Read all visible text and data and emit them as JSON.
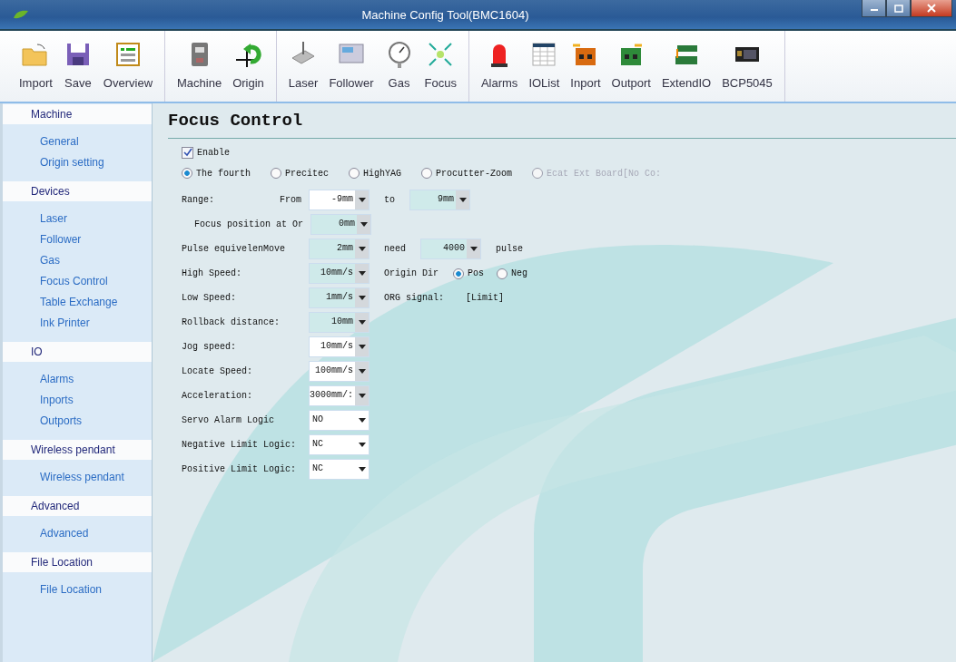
{
  "window": {
    "title": "Machine Config Tool(BMC1604)"
  },
  "toolbar": {
    "groups": [
      [
        {
          "label": "Import"
        },
        {
          "label": "Save"
        },
        {
          "label": "Overview"
        }
      ],
      [
        {
          "label": "Machine"
        },
        {
          "label": "Origin"
        }
      ],
      [
        {
          "label": "Laser"
        },
        {
          "label": "Follower"
        },
        {
          "label": "Gas"
        },
        {
          "label": "Focus"
        }
      ],
      [
        {
          "label": "Alarms"
        },
        {
          "label": "IOList"
        },
        {
          "label": "Inport"
        },
        {
          "label": "Outport"
        },
        {
          "label": "ExtendIO"
        },
        {
          "label": "BCP5045"
        }
      ]
    ]
  },
  "sidebar": {
    "sections": [
      {
        "title": "Machine",
        "items": [
          {
            "label": "General"
          },
          {
            "label": "Origin setting"
          }
        ]
      },
      {
        "title": "Devices",
        "items": [
          {
            "label": "Laser"
          },
          {
            "label": "Follower"
          },
          {
            "label": "Gas"
          },
          {
            "label": "Focus Control"
          },
          {
            "label": "Table Exchange"
          },
          {
            "label": "Ink Printer"
          }
        ]
      },
      {
        "title": "IO",
        "items": [
          {
            "label": "Alarms"
          },
          {
            "label": "Inports"
          },
          {
            "label": "Outports"
          }
        ]
      },
      {
        "title": "Wireless pendant",
        "items": [
          {
            "label": "Wireless pendant"
          }
        ]
      },
      {
        "title": "Advanced",
        "items": [
          {
            "label": "Advanced"
          }
        ]
      },
      {
        "title": "File Location",
        "items": [
          {
            "label": "File Location"
          }
        ]
      }
    ]
  },
  "page": {
    "title": "Focus Control",
    "enable": {
      "label": "Enable",
      "checked": true
    },
    "heads": [
      {
        "label": "The fourth",
        "selected": true,
        "disabled": false
      },
      {
        "label": "Precitec",
        "selected": false,
        "disabled": false
      },
      {
        "label": "HighYAG",
        "selected": false,
        "disabled": false
      },
      {
        "label": "Procutter-Zoom",
        "selected": false,
        "disabled": false
      },
      {
        "label": "Ecat Ext Board[No Co:",
        "selected": false,
        "disabled": true
      }
    ],
    "rows": [
      {
        "label": "Range:",
        "indent": false,
        "items": [
          {
            "kind": "text",
            "text": "From"
          },
          {
            "kind": "combo",
            "value": "-9mm",
            "white": true
          },
          {
            "kind": "text",
            "text": "to"
          },
          {
            "kind": "combo",
            "value": "9mm",
            "white": false
          }
        ]
      },
      {
        "label": "Focus position at Or",
        "indent": true,
        "items": [
          {
            "kind": "combo",
            "value": "0mm",
            "white": false
          }
        ]
      },
      {
        "label": "Pulse equivelenMove",
        "indent": false,
        "items": [
          {
            "kind": "combo",
            "value": "2mm",
            "white": false
          },
          {
            "kind": "text",
            "text": "need"
          },
          {
            "kind": "combo",
            "value": "4000",
            "white": false
          },
          {
            "kind": "text",
            "text": "pulse"
          }
        ]
      },
      {
        "label": "High Speed:",
        "indent": false,
        "items": [
          {
            "kind": "combo",
            "value": "10mm/s",
            "white": false
          },
          {
            "kind": "text",
            "text": "Origin Dir"
          },
          {
            "kind": "radio",
            "text": "Pos",
            "selected": true
          },
          {
            "kind": "radio",
            "text": "Neg",
            "selected": false
          }
        ]
      },
      {
        "label": "Low Speed:",
        "indent": false,
        "items": [
          {
            "kind": "combo",
            "value": "1mm/s",
            "white": false
          },
          {
            "kind": "text",
            "text": "ORG signal:"
          },
          {
            "kind": "text",
            "text": "[Limit]"
          }
        ]
      },
      {
        "label": "Rollback distance:",
        "indent": false,
        "items": [
          {
            "kind": "combo",
            "value": "10mm",
            "white": false
          }
        ]
      },
      {
        "label": "Jog speed:",
        "indent": false,
        "items": [
          {
            "kind": "combo",
            "value": "10mm/s",
            "white": true
          }
        ]
      },
      {
        "label": "Locate Speed:",
        "indent": false,
        "items": [
          {
            "kind": "combo",
            "value": "100mm/s",
            "white": true
          }
        ]
      },
      {
        "label": "Acceleration:",
        "indent": false,
        "items": [
          {
            "kind": "combo",
            "value": "3000mm/:",
            "white": true
          }
        ]
      },
      {
        "label": "Servo Alarm Logic",
        "indent": false,
        "items": [
          {
            "kind": "list",
            "value": "NO"
          }
        ]
      },
      {
        "label": "Negative Limit Logic:",
        "indent": false,
        "items": [
          {
            "kind": "list",
            "value": "NC"
          }
        ]
      },
      {
        "label": "Positive Limit Logic:",
        "indent": false,
        "items": [
          {
            "kind": "list",
            "value": "NC"
          }
        ]
      }
    ]
  }
}
